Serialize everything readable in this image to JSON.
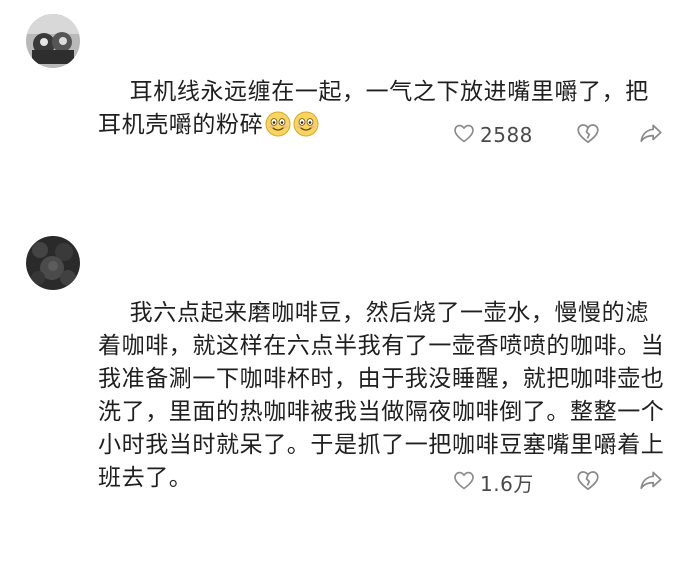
{
  "comments": [
    {
      "avatar": "user-avatar-photo",
      "text": "耳机线永远缠在一起，一气之下放进嘴里嚼了，把耳机壳嚼的粉碎",
      "emojis": [
        "smiling-face-icon",
        "smiling-face-icon"
      ],
      "likes": "2588",
      "icons": {
        "like": "heart-outline-icon",
        "dislike": "broken-heart-icon",
        "share": "share-arrow-icon"
      }
    },
    {
      "avatar": "user-avatar-photo",
      "text": "我六点起来磨咖啡豆，然后烧了一壶水，慢慢的滤着咖啡，就这样在六点半我有了一壶香喷喷的咖啡。当我准备涮一下咖啡杯时，由于我没睡醒，就把咖啡壶也洗了，里面的热咖啡被我当做隔夜咖啡倒了。整整一个小时我当时就呆了。于是抓了一把咖啡豆塞嘴里嚼着上班去了。",
      "likes": "1.6万",
      "icons": {
        "like": "heart-outline-icon",
        "dislike": "broken-heart-icon",
        "share": "share-arrow-icon"
      }
    }
  ],
  "colors": {
    "text": "#1f1f1f",
    "icon": "#8a8a8a",
    "count": "#4a4a4a",
    "emoji_face": "#f7d560"
  }
}
